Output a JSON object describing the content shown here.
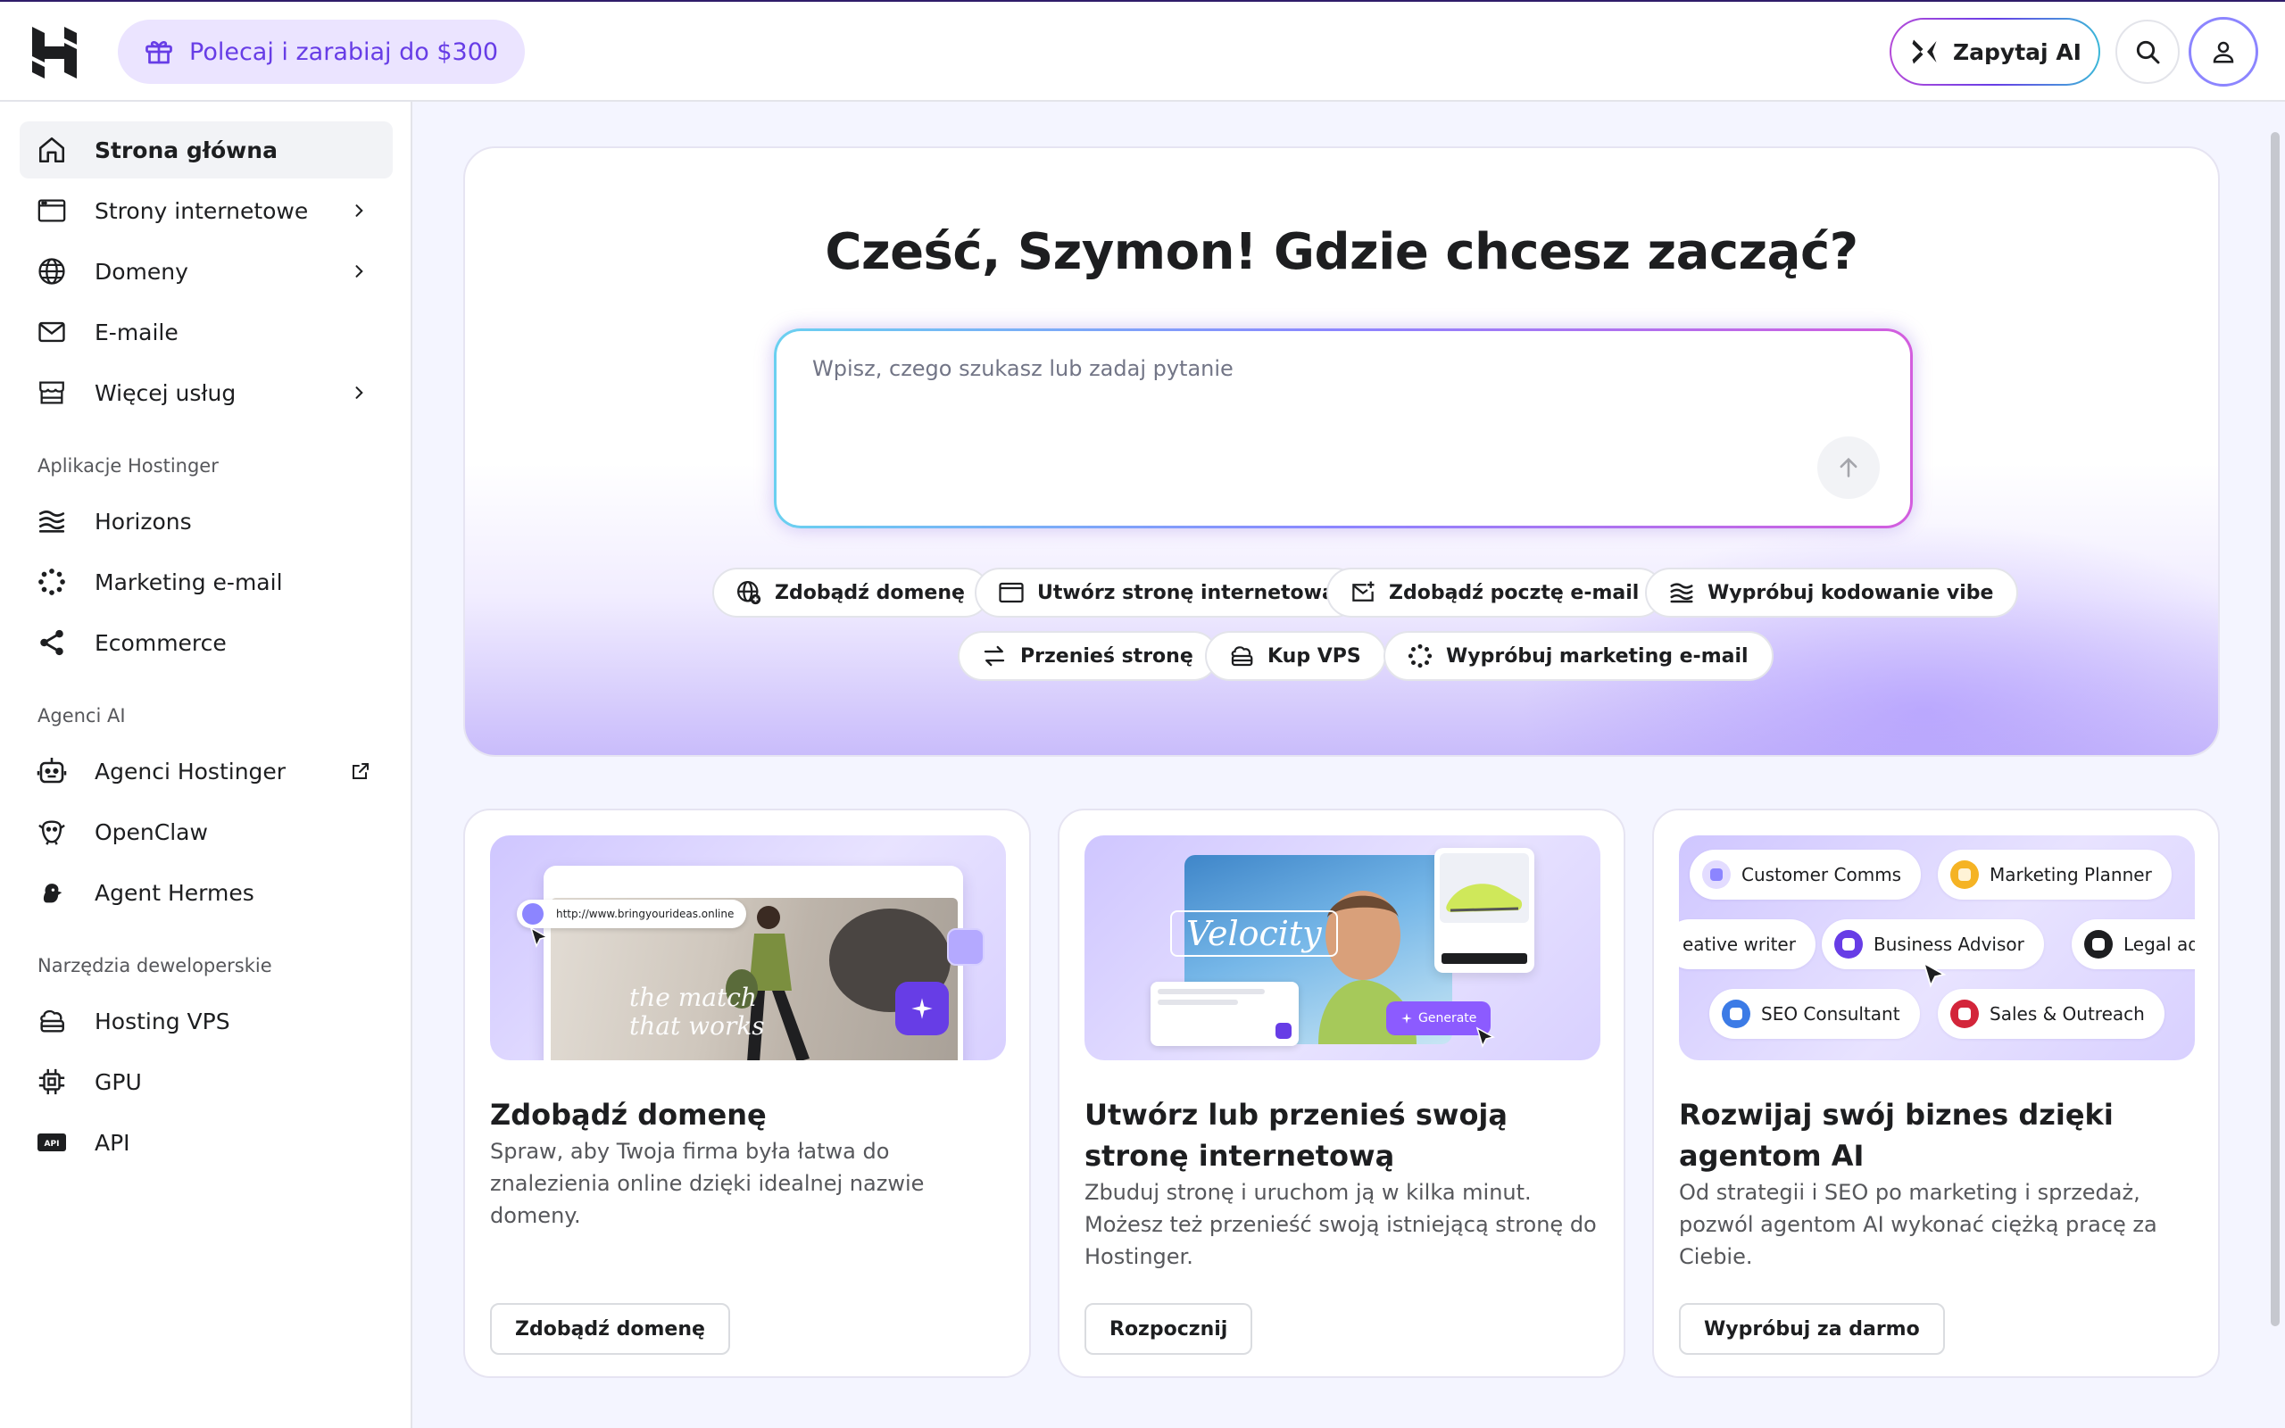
{
  "header": {
    "refer_label": "Polecaj i zarabiaj do $300",
    "ask_ai_label": "Zapytaj AI"
  },
  "sidebar": {
    "items": [
      {
        "label": "Strona główna",
        "icon": "home-icon"
      },
      {
        "label": "Strony internetowe",
        "icon": "browser-window-icon"
      },
      {
        "label": "Domeny",
        "icon": "globe-icon"
      },
      {
        "label": "E-maile",
        "icon": "mail-icon"
      },
      {
        "label": "Więcej usług",
        "icon": "store-icon"
      }
    ],
    "sections": [
      {
        "title": "Aplikacje Hostinger",
        "items": [
          {
            "label": "Horizons",
            "icon": "horizons-icon"
          },
          {
            "label": "Marketing e-mail",
            "icon": "reach-icon"
          },
          {
            "label": "Ecommerce",
            "icon": "ecommerce-icon"
          }
        ]
      },
      {
        "title": "Agenci AI",
        "items": [
          {
            "label": "Agenci Hostinger",
            "icon": "robot-icon"
          },
          {
            "label": "OpenClaw",
            "icon": "claw-icon"
          },
          {
            "label": "Agent Hermes",
            "icon": "hermes-icon"
          }
        ]
      },
      {
        "title": "Narzędzia deweloperskie",
        "items": [
          {
            "label": "Hosting VPS",
            "icon": "cloud-server-icon"
          },
          {
            "label": "GPU",
            "icon": "chip-icon"
          },
          {
            "label": "API",
            "icon": "api-icon"
          }
        ]
      }
    ]
  },
  "hero": {
    "title": "Cześć, Szymon! Gdzie chcesz zacząć?",
    "prompt_placeholder": "Wpisz, czego szukasz lub zadaj pytanie",
    "chips_row1": [
      "Zdobądź domenę",
      "Utwórz stronę internetową",
      "Zdobądź pocztę e-mail",
      "Wypróbuj kodowanie vibe"
    ],
    "chips_row2": [
      "Przenieś stronę",
      "Kup VPS",
      "Wypróbuj marketing e-mail"
    ]
  },
  "cards": [
    {
      "title": "Zdobądź domenę",
      "desc": "Spraw, aby Twoja firma była łatwa do znalezienia online dzięki idealnej nazwie domeny.",
      "button": "Zdobądź domenę",
      "art": {
        "url": "http://www.bringyourideas.online",
        "tagline_1": "the match",
        "tagline_2": "that works"
      }
    },
    {
      "title": "Utwórz lub przenieś swoją stronę internetową",
      "desc": "Zbuduj stronę i uruchom ją w kilka minut. Możesz też przenieść swoją istniejącą stronę do Hostinger.",
      "button": "Rozpocznij",
      "art": {
        "brand": "Velocity",
        "generate": "Generate"
      }
    },
    {
      "title": "Rozwijaj swój biznes dzięki agentom AI",
      "desc": "Od strategii i SEO po marketing i sprzedaż, pozwól agentom AI wykonać ciężką pracę za Ciebie.",
      "button": "Wypróbuj za darmo",
      "art": {
        "agents": [
          "Customer Comms",
          "Marketing Planner",
          "eative writer",
          "Business Advisor",
          "Legal ad",
          "SEO Consultant",
          "Sales & Outreach"
        ]
      }
    }
  ],
  "colors": {
    "accent": "#673de6",
    "accent_light": "#ebe4ff",
    "text": "#1d1e20",
    "muted": "#56575b"
  }
}
